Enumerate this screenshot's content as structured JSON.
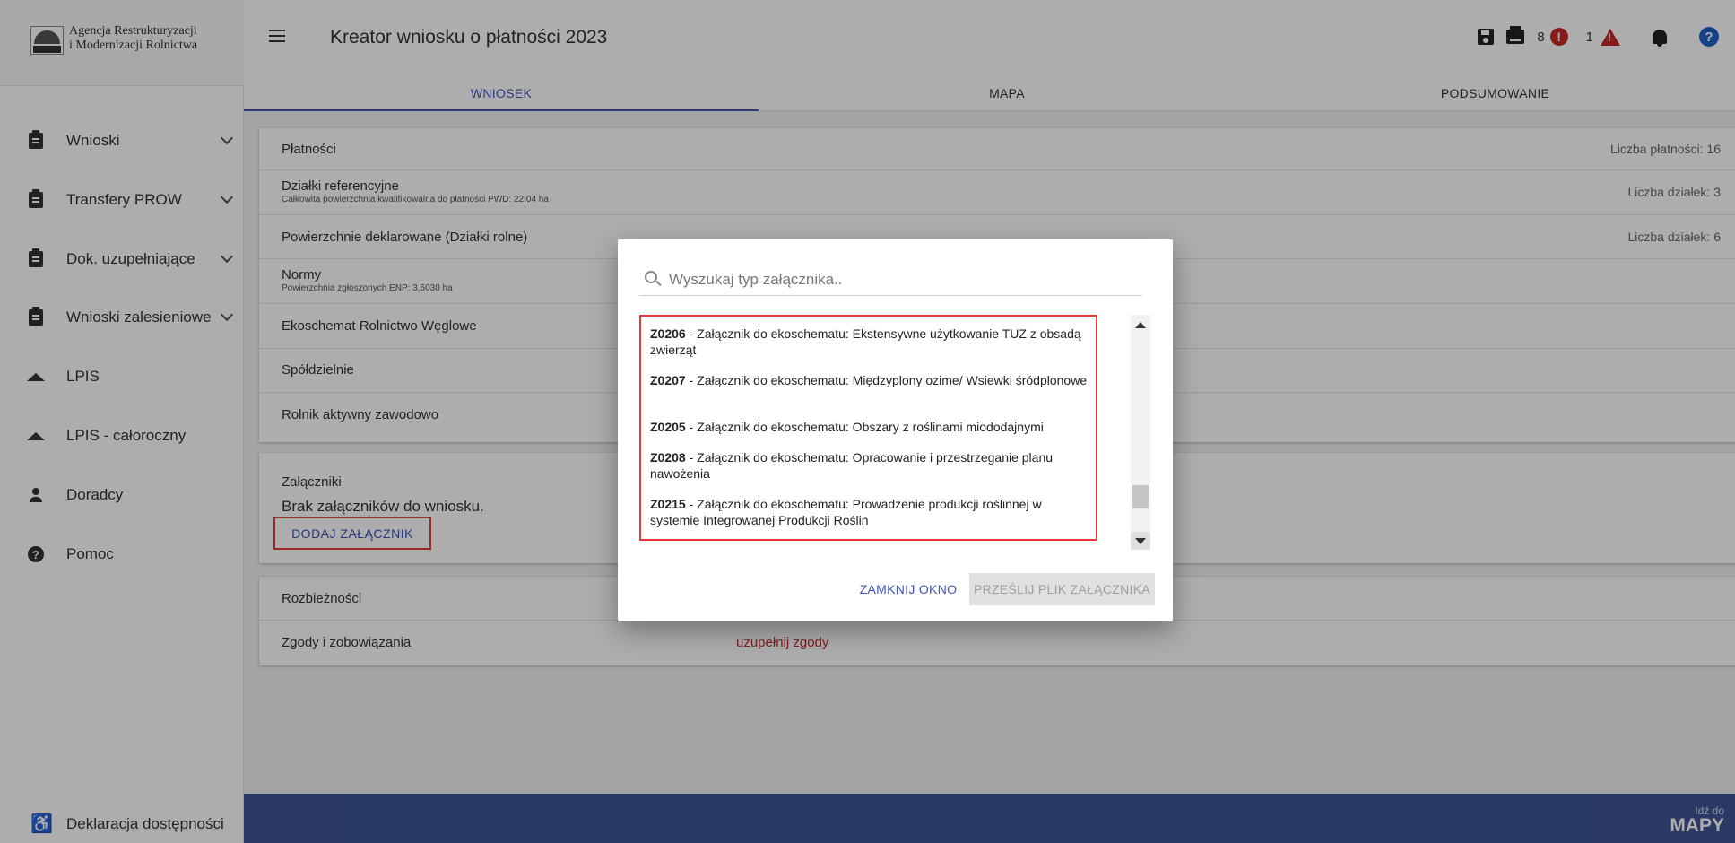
{
  "logo": {
    "line1": "Agencja Restrukturyzacji",
    "line2": "i Modernizacji Rolnictwa"
  },
  "sidebar": {
    "items": [
      {
        "label": "Wnioski",
        "icon": "clipboard-icon",
        "expandable": true
      },
      {
        "label": "Transfery PROW",
        "icon": "clipboard-icon",
        "expandable": true
      },
      {
        "label": "Dok. uzupełniające",
        "icon": "clipboard-icon",
        "expandable": true
      },
      {
        "label": "Wnioski zalesieniowe",
        "icon": "clipboard-icon",
        "expandable": true
      },
      {
        "label": "LPIS",
        "icon": "terrain-icon",
        "expandable": false
      },
      {
        "label": "LPIS - całoroczny",
        "icon": "terrain-icon",
        "expandable": false
      },
      {
        "label": "Doradcy",
        "icon": "person-icon",
        "expandable": false
      },
      {
        "label": "Pomoc",
        "icon": "help-icon",
        "expandable": false
      }
    ],
    "accessibility_label": "Deklaracja dostępności"
  },
  "header": {
    "title": "Kreator wniosku o płatności 2023",
    "error_count": "8",
    "warning_count": "1",
    "help_glyph": "?"
  },
  "tabs": [
    {
      "label": "WNIOSEK",
      "active": true
    },
    {
      "label": "MAPA",
      "active": false
    },
    {
      "label": "PODSUMOWANIE",
      "active": false
    }
  ],
  "sections": {
    "platnosci": {
      "label": "Płatności",
      "right": "Liczba płatności: 16"
    },
    "dzialki": {
      "label": "Działki referencyjne",
      "sub": "Całkowita powierzchnia kwalifikowalna do płatności PWD: 22,04 ha",
      "right": "Liczba działek: 3"
    },
    "powierzchnie": {
      "label": "Powierzchnie deklarowane (Działki rolne)",
      "right": "Liczba działek: 6"
    },
    "normy": {
      "label": "Normy",
      "sub": "Powierzchnia zgłoszonych ENP: 3,5030 ha"
    },
    "ekoschemat": {
      "label": "Ekoschemat Rolnictwo Węglowe"
    },
    "spoldzielnie": {
      "label": "Spółdzielnie"
    },
    "rolnik": {
      "label": "Rolnik aktywny zawodowo"
    },
    "zalaczniki": {
      "label": "Załączniki",
      "empty_text": "Brak załączników do wniosku.",
      "add_button": "DODAJ ZAŁĄCZNIK"
    },
    "rozbieznosci": {
      "label": "Rozbieżności"
    },
    "zgody": {
      "label": "Zgody i zobowiązania",
      "warning": "uzupełnij zgody"
    }
  },
  "footer": {
    "map_small": "Idź do",
    "map_big": "MAPY"
  },
  "dialog": {
    "search_placeholder": "Wyszukaj typ załącznika..",
    "items": [
      {
        "code": "Z0206",
        "text": " - Załącznik do ekoschematu: Ekstensywne użytkowanie TUZ z obsadą zwierząt"
      },
      {
        "code": "Z0207",
        "text": " - Załącznik do ekoschematu: Międzyplony ozime/ Wsiewki śródplonowe"
      },
      {
        "code": "Z0205",
        "text": " - Załącznik do ekoschematu: Obszary z roślinami miododajnymi"
      },
      {
        "code": "Z0208",
        "text": " - Załącznik do ekoschematu: Opracowanie i przestrzeganie planu nawożenia"
      },
      {
        "code": "Z0215",
        "text": " - Załącznik do ekoschematu: Prowadzenie produkcji roślinnej w systemie Integrowanej Produkcji Roślin"
      }
    ],
    "close_button": "ZAMKNIJ OKNO",
    "send_button": "PRZEŚLIJ PLIK ZAŁĄCZNIKA"
  }
}
